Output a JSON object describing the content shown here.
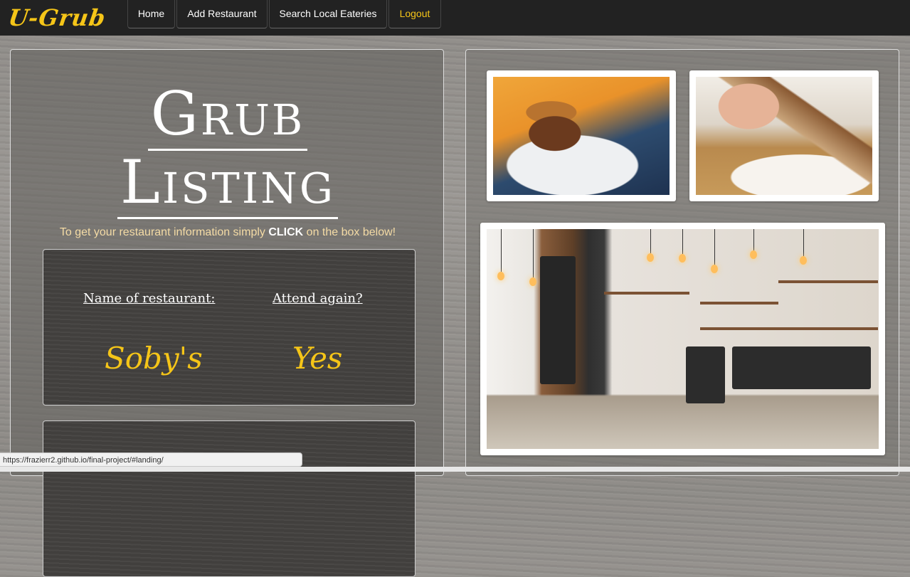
{
  "brand": "U-Grub",
  "nav": {
    "home": "Home",
    "add_restaurant": "Add Restaurant",
    "search": "Search Local Eateries",
    "logout": "Logout"
  },
  "main": {
    "title_line1": "Grub",
    "title_line2": "Listing",
    "subtitle_pre": "To get your restaurant information simply ",
    "subtitle_bold": "CLICK",
    "subtitle_post": " on the box below!",
    "listings": [
      {
        "name_header": "Name of restaurant:",
        "attend_header": "Attend again?",
        "name": "Soby's",
        "attend": "Yes"
      },
      {
        "name_header": "",
        "attend_header": "",
        "name": "",
        "attend": ""
      }
    ]
  },
  "status_url": "https://frazierr2.github.io/final-project/#landing/",
  "colors": {
    "accent": "#f5c518",
    "navbar": "#222222",
    "subtitle": "#f4dba5"
  }
}
